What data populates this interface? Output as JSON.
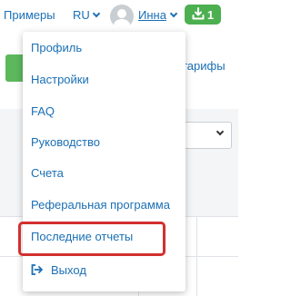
{
  "header": {
    "examples_label": "Примеры",
    "lang_label": "RU",
    "user_name": "Инна",
    "download_count": "1"
  },
  "background": {
    "tariffs_text": "тарифы"
  },
  "menu": {
    "items": [
      {
        "label": "Профиль"
      },
      {
        "label": "Настройки"
      },
      {
        "label": "FAQ"
      },
      {
        "label": "Руководство"
      },
      {
        "label": "Счета"
      },
      {
        "label": "Реферальная программа"
      },
      {
        "label": "Последние отчеты"
      },
      {
        "label": "Выход"
      }
    ]
  },
  "colors": {
    "link": "#1a6fb5",
    "badge": "#4caf50",
    "highlight": "#d32f2f"
  }
}
